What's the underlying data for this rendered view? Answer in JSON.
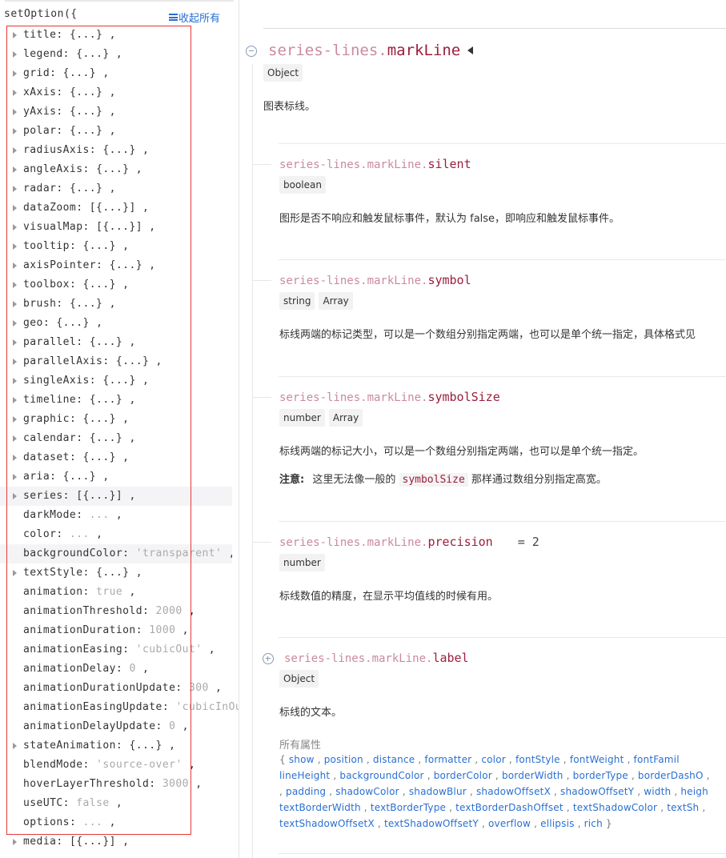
{
  "tree": {
    "header": "setOption({",
    "collapse_all": "收起所有",
    "items": [
      {
        "key": "title",
        "value": "{...}",
        "expandable": true
      },
      {
        "key": "legend",
        "value": "{...}",
        "expandable": true
      },
      {
        "key": "grid",
        "value": "{...}",
        "expandable": true
      },
      {
        "key": "xAxis",
        "value": "{...}",
        "expandable": true
      },
      {
        "key": "yAxis",
        "value": "{...}",
        "expandable": true
      },
      {
        "key": "polar",
        "value": "{...}",
        "expandable": true
      },
      {
        "key": "radiusAxis",
        "value": "{...}",
        "expandable": true
      },
      {
        "key": "angleAxis",
        "value": "{...}",
        "expandable": true
      },
      {
        "key": "radar",
        "value": "{...}",
        "expandable": true
      },
      {
        "key": "dataZoom",
        "value": "[{...}]",
        "expandable": true
      },
      {
        "key": "visualMap",
        "value": "[{...}]",
        "expandable": true
      },
      {
        "key": "tooltip",
        "value": "{...}",
        "expandable": true
      },
      {
        "key": "axisPointer",
        "value": "{...}",
        "expandable": true
      },
      {
        "key": "toolbox",
        "value": "{...}",
        "expandable": true
      },
      {
        "key": "brush",
        "value": "{...}",
        "expandable": true
      },
      {
        "key": "geo",
        "value": "{...}",
        "expandable": true
      },
      {
        "key": "parallel",
        "value": "{...}",
        "expandable": true
      },
      {
        "key": "parallelAxis",
        "value": "{...}",
        "expandable": true
      },
      {
        "key": "singleAxis",
        "value": "{...}",
        "expandable": true
      },
      {
        "key": "timeline",
        "value": "{...}",
        "expandable": true
      },
      {
        "key": "graphic",
        "value": "{...}",
        "expandable": true
      },
      {
        "key": "calendar",
        "value": "{...}",
        "expandable": true
      },
      {
        "key": "dataset",
        "value": "{...}",
        "expandable": true
      },
      {
        "key": "aria",
        "value": "{...}",
        "expandable": true
      },
      {
        "key": "series",
        "value": "[{...}]",
        "expandable": true,
        "highlight": true
      },
      {
        "key": "darkMode",
        "value": "...",
        "expandable": false,
        "leaf_value": true
      },
      {
        "key": "color",
        "value": "...",
        "expandable": false,
        "leaf_value": true
      },
      {
        "key": "backgroundColor",
        "value": "'transparent'",
        "expandable": false,
        "leaf_value": true,
        "highlight": true
      },
      {
        "key": "textStyle",
        "value": "{...}",
        "expandable": true
      },
      {
        "key": "animation",
        "value": "true",
        "expandable": false,
        "leaf_value": true
      },
      {
        "key": "animationThreshold",
        "value": "2000",
        "expandable": false,
        "leaf_value": true
      },
      {
        "key": "animationDuration",
        "value": "1000",
        "expandable": false,
        "leaf_value": true
      },
      {
        "key": "animationEasing",
        "value": "'cubicOut'",
        "expandable": false,
        "leaf_value": true
      },
      {
        "key": "animationDelay",
        "value": "0",
        "expandable": false,
        "leaf_value": true
      },
      {
        "key": "animationDurationUpdate",
        "value": "300",
        "expandable": false,
        "leaf_value": true
      },
      {
        "key": "animationEasingUpdate",
        "value": "'cubicInOu",
        "expandable": false,
        "leaf_value": true,
        "truncated": true
      },
      {
        "key": "animationDelayUpdate",
        "value": "0",
        "expandable": false,
        "leaf_value": true
      },
      {
        "key": "stateAnimation",
        "value": "{...}",
        "expandable": true
      },
      {
        "key": "blendMode",
        "value": "'source-over'",
        "expandable": false,
        "leaf_value": true
      },
      {
        "key": "hoverLayerThreshold",
        "value": "3000",
        "expandable": false,
        "leaf_value": true
      },
      {
        "key": "useUTC",
        "value": "false",
        "expandable": false,
        "leaf_value": true
      },
      {
        "key": "options",
        "value": "...",
        "expandable": false,
        "leaf_value": true
      },
      {
        "key": "media",
        "value": "[{...}]",
        "expandable": true
      }
    ]
  },
  "doc": {
    "main": {
      "prefix": "series-lines.",
      "name": "markLine",
      "types": [
        "Object"
      ],
      "description": "图表标线。"
    },
    "props": [
      {
        "prefix": "series-lines.markLine.",
        "name": "silent",
        "types": [
          "boolean"
        ],
        "description": "图形是否不响应和触发鼠标事件，默认为 false，即响应和触发鼠标事件。"
      },
      {
        "prefix": "series-lines.markLine.",
        "name": "symbol",
        "types": [
          "string",
          "Array"
        ],
        "description": "标线两端的标记类型，可以是一个数组分别指定两端，也可以是单个统一指定，具体格式见"
      },
      {
        "prefix": "series-lines.markLine.",
        "name": "symbolSize",
        "types": [
          "number",
          "Array"
        ],
        "description": "标线两端的标记大小，可以是一个数组分别指定两端，也可以是单个统一指定。",
        "note_label": "注意:",
        "note_before": "这里无法像一般的",
        "note_code": "symbolSize",
        "note_after": "那样通过数组分别指定高宽。"
      },
      {
        "prefix": "series-lines.markLine.",
        "name": "precision",
        "default": "= 2",
        "types": [
          "number"
        ],
        "description": "标线数值的精度，在显示平均值线的时候有用。"
      },
      {
        "prefix": "series-lines.markLine.",
        "name": "label",
        "types": [
          "Object"
        ],
        "description": "标线的文本。",
        "all_props_label": "所有属性",
        "attr_lines": [
          {
            "lead": "{ ",
            "items": [
              "show",
              "position",
              "distance",
              "formatter",
              "color",
              "fontStyle",
              "fontWeight",
              "fontFamil"
            ]
          },
          {
            "lead": "",
            "items": [
              "lineHeight",
              "backgroundColor",
              "borderColor",
              "borderWidth",
              "borderType",
              "borderDashO"
            ]
          },
          {
            "lead": ", ",
            "items": [
              "padding",
              "shadowColor",
              "shadowBlur",
              "shadowOffsetX",
              "shadowOffsetY",
              "width",
              "heigh"
            ]
          },
          {
            "lead": "",
            "items": [
              "textBorderWidth",
              "textBorderType",
              "textBorderDashOffset",
              "textShadowColor",
              "textSh"
            ]
          },
          {
            "lead": "",
            "items": [
              "textShadowOffsetX",
              "textShadowOffsetY",
              "overflow",
              "ellipsis",
              "rich"
            ],
            "trail": " }"
          }
        ]
      }
    ]
  },
  "colors": {
    "link": "#2a6fd1",
    "prop_name": "#9b1e3c",
    "prop_prefix": "#c98aa0",
    "highlight_border": "#e53935"
  }
}
